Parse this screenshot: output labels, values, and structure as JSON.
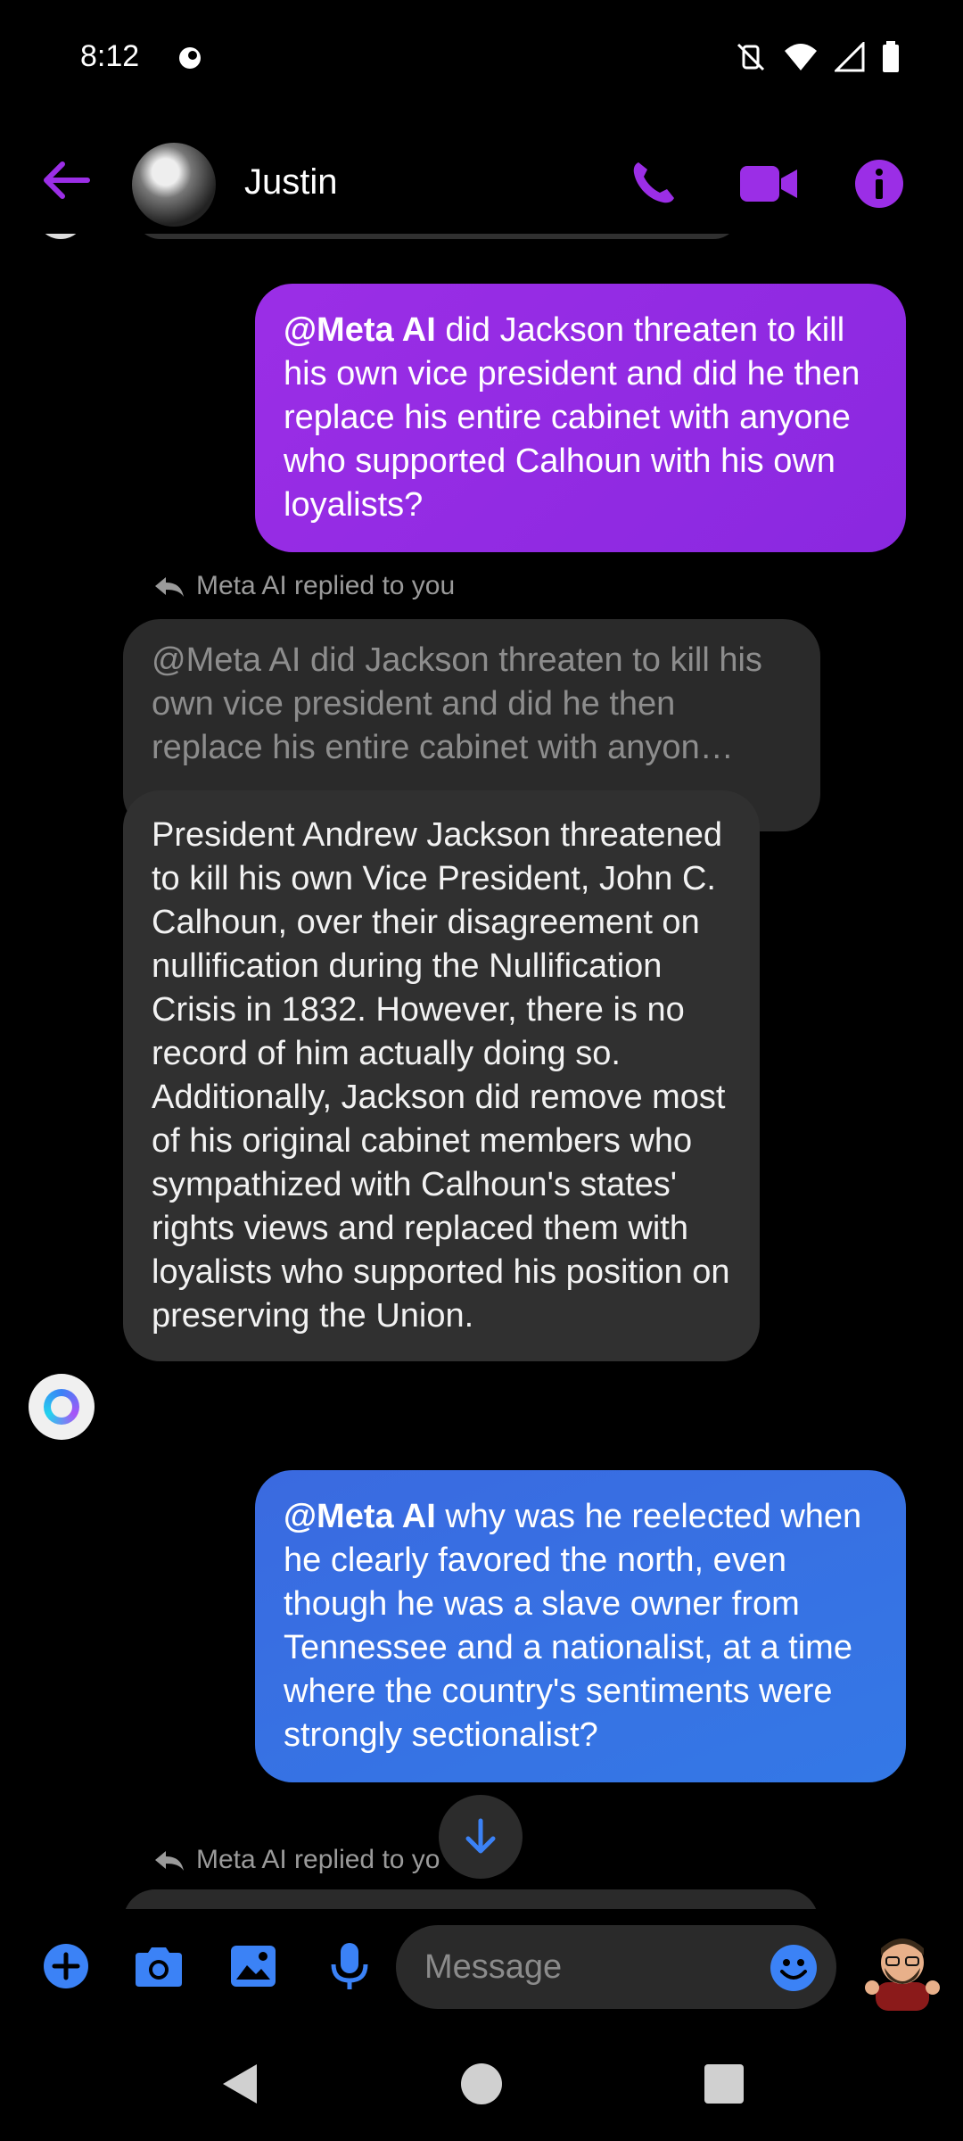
{
  "status_bar": {
    "time": "8:12"
  },
  "header": {
    "contact_name": "Justin"
  },
  "messages": {
    "outgoing_1": {
      "mention": "@Meta AI",
      "text": " did Jackson threaten to kill his own vice president and did he then replace his entire cabinet with anyone who supported Calhoun with his own loyalists?"
    },
    "reply_label_1": "Meta AI replied to you",
    "quoted": "@Meta AI did Jackson threaten to kill his own vice president and did he then replace his entire cabinet with anyon…",
    "incoming": "President Andrew Jackson threatened to kill his own Vice President, John C. Calhoun, over their disagreement on nullification during the Nullification Crisis in 1832. However, there is no record of him actually doing so. Additionally, Jackson did remove most of his original cabinet members who sympathized with Calhoun's states' rights views and replaced them with loyalists who supported his position on preserving the Union.",
    "outgoing_2": {
      "mention": "@Meta AI",
      "text": " why was he reelected when he clearly favored the north, even though he was a slave owner from Tennessee and a nationalist, at a time where the country's sentiments were strongly sectionalist?"
    },
    "reply_label_2": "Meta AI replied to yo"
  },
  "composer": {
    "placeholder": "Message"
  },
  "colors": {
    "accent_purple": "#9b2ee6",
    "outgoing_blue": "#3478e6",
    "composer_blue": "#3b82f6",
    "incoming_bubble": "#303030"
  },
  "icons": [
    "back-arrow-icon",
    "phone-icon",
    "video-camera-icon",
    "info-icon",
    "plus-icon",
    "camera-icon",
    "image-icon",
    "microphone-icon",
    "emoji-icon",
    "arrow-down-icon",
    "reply-arrow-icon"
  ]
}
